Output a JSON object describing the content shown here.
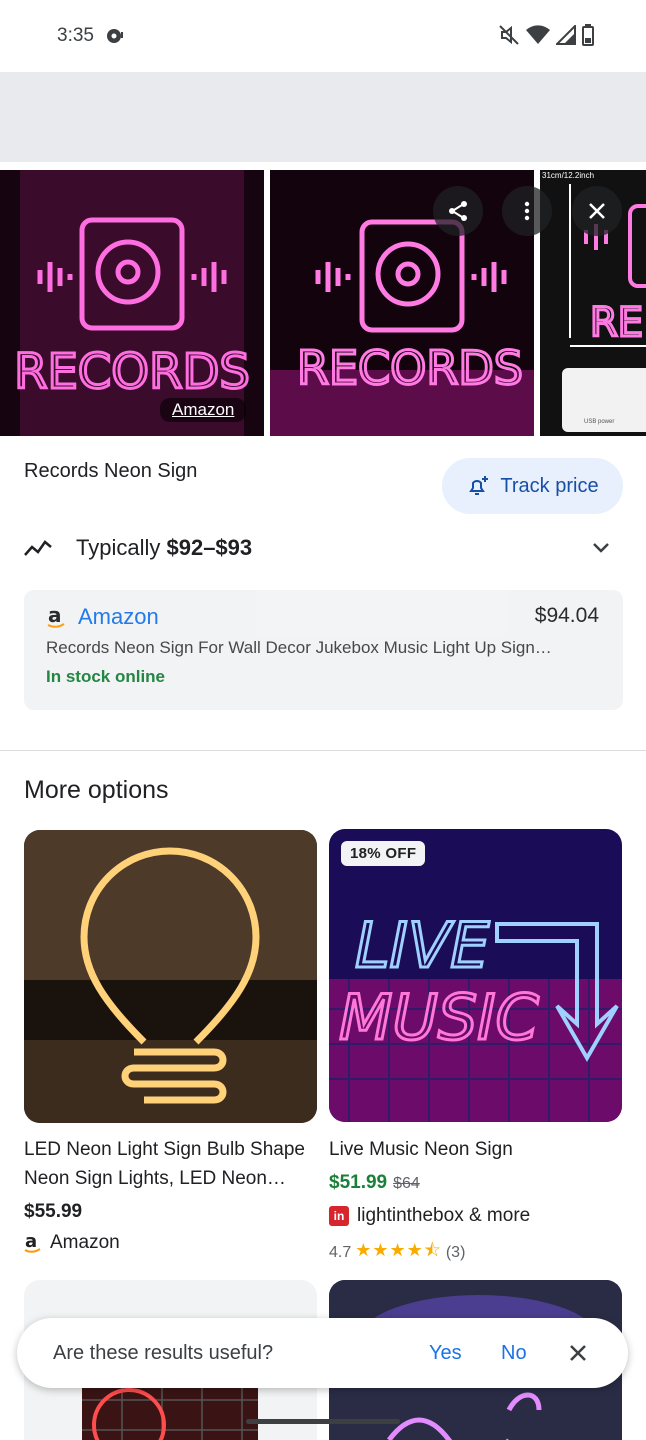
{
  "status_bar": {
    "time": "3:35"
  },
  "carousel": {
    "source_label": "Amazon",
    "dimension_label": "31cm/12.2inch",
    "usb_label": "USB power"
  },
  "product": {
    "title": "Records Neon Sign",
    "track_price_label": "Track price",
    "typical_prefix": "Typically ",
    "typical_range": "$92–$93"
  },
  "offer": {
    "store": "Amazon",
    "price": "$94.04",
    "description": "Records Neon Sign For Wall Decor Jukebox Music Light Up Sign…",
    "stock": "In stock online"
  },
  "more_options": {
    "title": "More options",
    "items": [
      {
        "title_line1": "LED Neon Light Sign Bulb Shape",
        "title_line2": "Neon Sign Lights, LED Neon…",
        "price": "$55.99",
        "store": "Amazon"
      },
      {
        "badge": "18% OFF",
        "title": "Live Music Neon Sign",
        "price": "$51.99",
        "old_price": "$64",
        "store": "lightinthebox & more",
        "rating": "4.7",
        "rating_value": 4.7,
        "reviews": "(3)",
        "store_icon_text": "in"
      }
    ]
  },
  "feedback": {
    "question": "Are these results useful?",
    "yes": "Yes",
    "no": "No"
  },
  "colors": {
    "accent": "#1a73e8",
    "green": "#188038",
    "star": "#f9ab00",
    "neon_pink": "#ff4fd8"
  }
}
